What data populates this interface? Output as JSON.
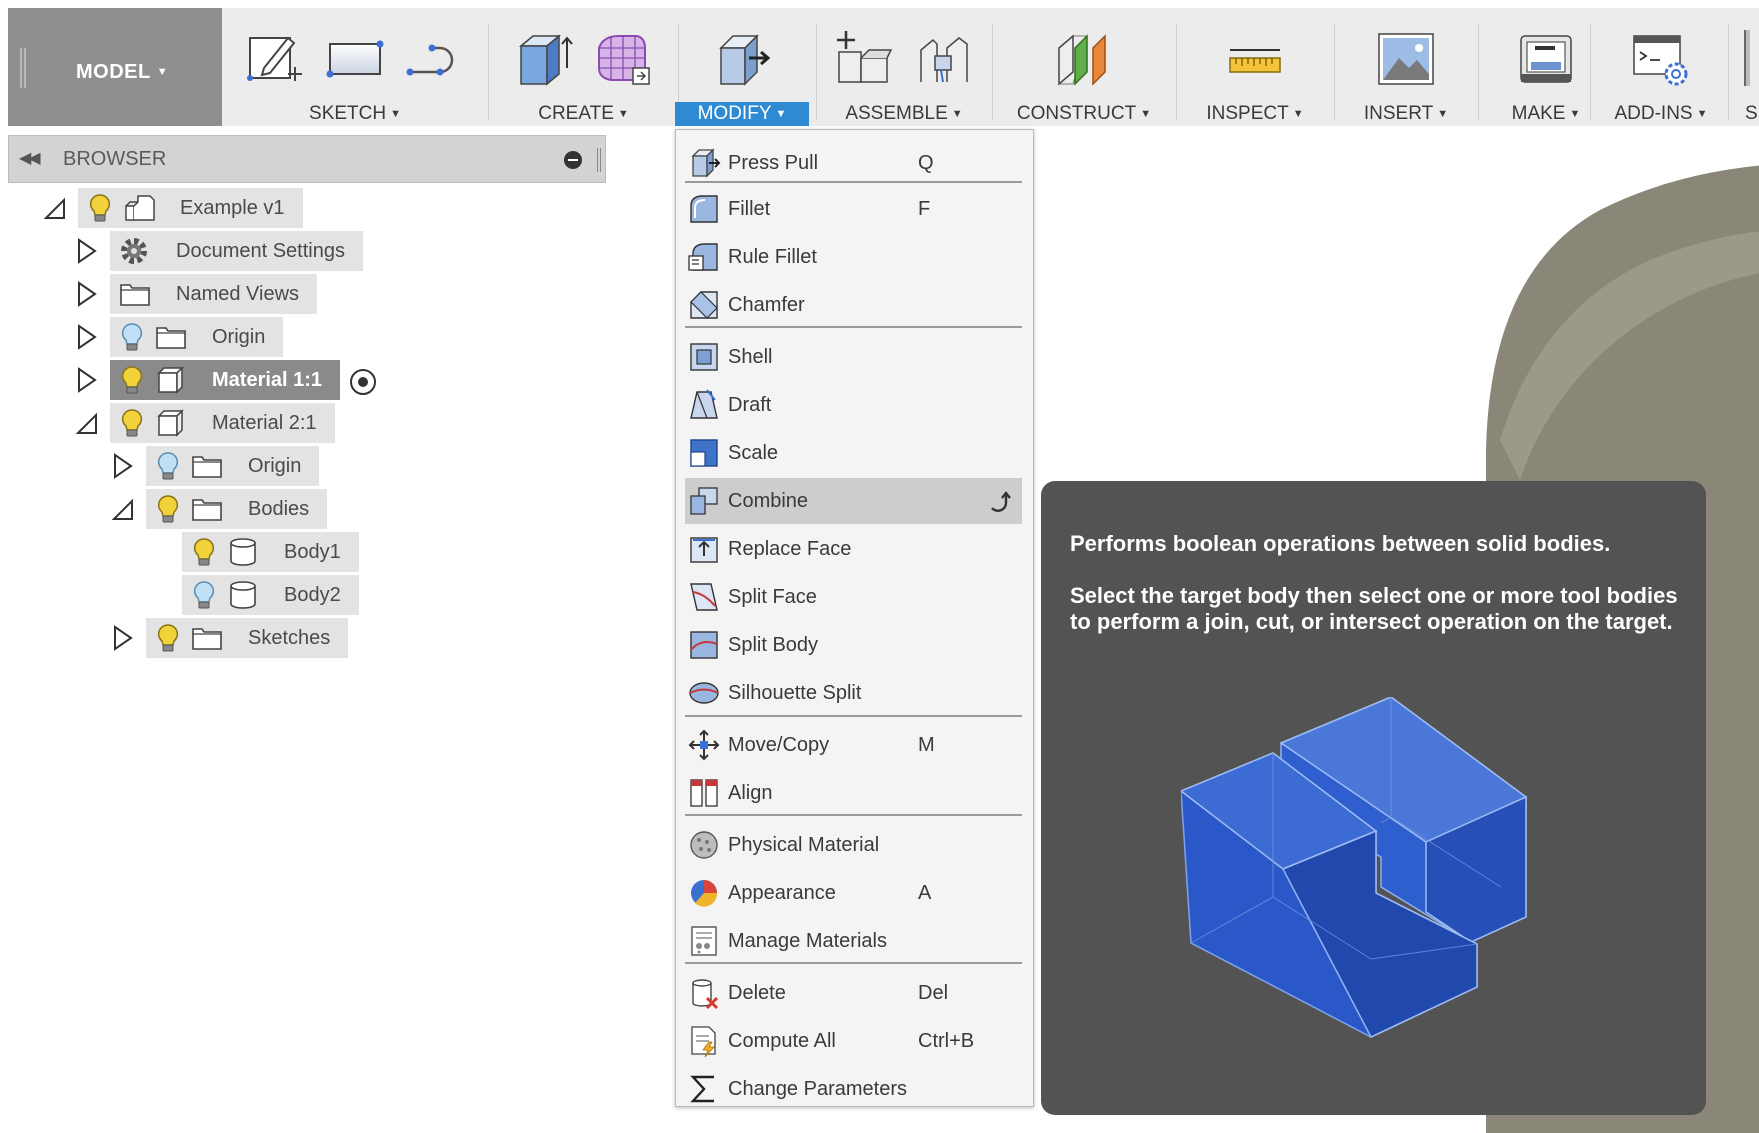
{
  "toolbar": {
    "workspace": "MODEL",
    "groups": [
      {
        "label": "SKETCH",
        "icons": [
          "sketch-pencil-icon",
          "rectangle-icon",
          "line-arc-icon"
        ]
      },
      {
        "label": "CREATE",
        "icons": [
          "extrude-box-icon",
          "form-grid-box-icon"
        ]
      },
      {
        "label": "MODIFY",
        "icons": [
          "press-pull-box-icon"
        ],
        "active": true
      },
      {
        "label": "ASSEMBLE",
        "icons": [
          "new-component-icon",
          "joint-icon"
        ]
      },
      {
        "label": "CONSTRUCT",
        "icons": [
          "construct-plane-icon"
        ]
      },
      {
        "label": "INSPECT",
        "icons": [
          "measure-ruler-icon"
        ]
      },
      {
        "label": "INSERT",
        "icons": [
          "insert-image-icon"
        ]
      },
      {
        "label": "MAKE",
        "icons": [
          "print-3d-icon"
        ]
      },
      {
        "label": "ADD-INS",
        "icons": [
          "scripts-addins-icon"
        ]
      },
      {
        "label": "S",
        "icons": []
      }
    ]
  },
  "browser": {
    "title": "BROWSER",
    "nodes": [
      {
        "label": "Example v1",
        "arrow": "expanded",
        "bulb": "on",
        "icon": "component-doc-icon"
      },
      {
        "label": "Document Settings",
        "arrow": "collapsed",
        "bulb": "none",
        "icon": "gear-icon"
      },
      {
        "label": "Named Views",
        "arrow": "collapsed",
        "bulb": "none",
        "icon": "folder-icon"
      },
      {
        "label": "Origin",
        "arrow": "collapsed",
        "bulb": "off",
        "icon": "folder-icon"
      },
      {
        "label": "Material 1:1",
        "arrow": "collapsed",
        "bulb": "on",
        "icon": "component-box-icon",
        "selected": true
      },
      {
        "label": "Material 2:1",
        "arrow": "expanded",
        "bulb": "on",
        "icon": "component-box-icon"
      },
      {
        "label": "Origin",
        "arrow": "collapsed",
        "bulb": "off",
        "icon": "folder-icon"
      },
      {
        "label": "Bodies",
        "arrow": "expanded",
        "bulb": "on",
        "icon": "folder-icon"
      },
      {
        "label": "Body1",
        "arrow": "none",
        "bulb": "on",
        "icon": "body-cylinder-icon"
      },
      {
        "label": "Body2",
        "arrow": "none",
        "bulb": "off",
        "icon": "body-cylinder-icon"
      },
      {
        "label": "Sketches",
        "arrow": "collapsed",
        "bulb": "on",
        "icon": "folder-icon"
      }
    ]
  },
  "menu": {
    "items": [
      {
        "label": "Press Pull",
        "shortcut": "Q",
        "icon": "press-pull-icon"
      },
      {
        "label": "Fillet",
        "shortcut": "F",
        "icon": "fillet-icon"
      },
      {
        "label": "Rule Fillet",
        "shortcut": "",
        "icon": "rule-fillet-icon"
      },
      {
        "label": "Chamfer",
        "shortcut": "",
        "icon": "chamfer-icon"
      },
      {
        "label": "Shell",
        "shortcut": "",
        "icon": "shell-icon"
      },
      {
        "label": "Draft",
        "shortcut": "",
        "icon": "draft-icon"
      },
      {
        "label": "Scale",
        "shortcut": "",
        "icon": "scale-icon"
      },
      {
        "label": "Combine",
        "shortcut": "",
        "icon": "combine-icon",
        "highlighted": true
      },
      {
        "label": "Replace Face",
        "shortcut": "",
        "icon": "replace-face-icon"
      },
      {
        "label": "Split Face",
        "shortcut": "",
        "icon": "split-face-icon"
      },
      {
        "label": "Split Body",
        "shortcut": "",
        "icon": "split-body-icon"
      },
      {
        "label": "Silhouette Split",
        "shortcut": "",
        "icon": "silhouette-split-icon"
      },
      {
        "label": "Move/Copy",
        "shortcut": "M",
        "icon": "move-copy-icon"
      },
      {
        "label": "Align",
        "shortcut": "",
        "icon": "align-icon"
      },
      {
        "label": "Physical Material",
        "shortcut": "",
        "icon": "physical-material-icon"
      },
      {
        "label": "Appearance",
        "shortcut": "A",
        "icon": "appearance-icon"
      },
      {
        "label": "Manage Materials",
        "shortcut": "",
        "icon": "manage-materials-icon"
      },
      {
        "label": "Delete",
        "shortcut": "Del",
        "icon": "delete-icon"
      },
      {
        "label": "Compute All",
        "shortcut": "Ctrl+B",
        "icon": "compute-all-icon"
      },
      {
        "label": "Change Parameters",
        "shortcut": "",
        "icon": "sigma-icon"
      }
    ]
  },
  "tooltip": {
    "line1": "Performs boolean operations between solid bodies.",
    "line2": "Select the target body then select one or more tool bodies to perform a join, cut, or intersect operation on the target."
  },
  "colors": {
    "toolbar_bg": "#ececec",
    "workspace_bg": "#8f8f8f",
    "active_blue": "#2d8ad3",
    "menu_highlight": "#cdcdcd",
    "tooltip_bg": "#535353",
    "body_blue": "#2a58c8",
    "viewport_body": "#8c8a7c"
  }
}
